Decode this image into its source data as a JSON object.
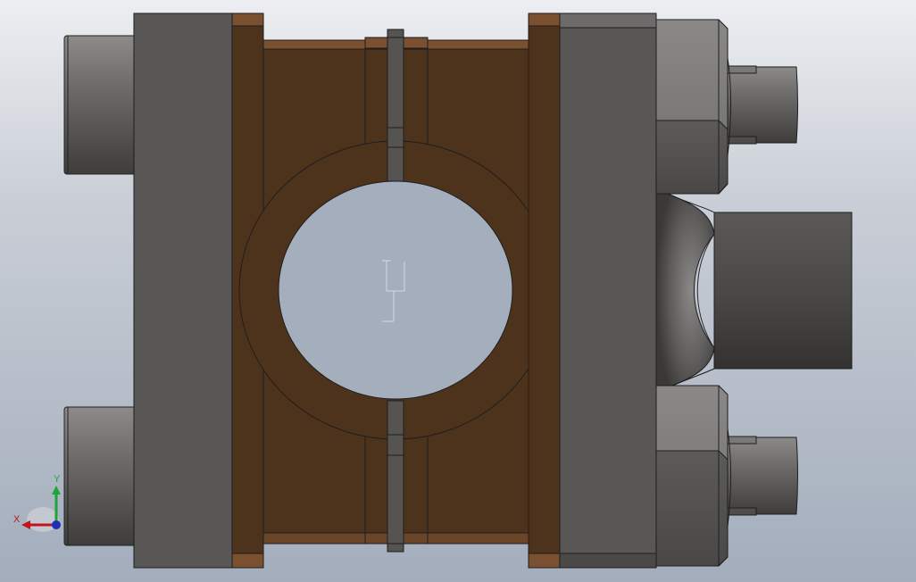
{
  "viewport": {
    "background_top": "#eceef1",
    "background_bottom": "#a3adbc"
  },
  "triad": {
    "x_label": "X",
    "y_label": "Y",
    "x_color": "#c0161b",
    "y_color": "#1fa43a",
    "z_color": "#1d2fb4"
  },
  "model": {
    "clamp_color": "#4e331c",
    "clamp_edge_color": "#7a5030",
    "plate_color": "#585755",
    "bolt_color": "#6c6b69",
    "icons": [
      "bolt-icon",
      "nut-icon",
      "pipe-stub-icon",
      "coordinate-triad-icon"
    ]
  }
}
